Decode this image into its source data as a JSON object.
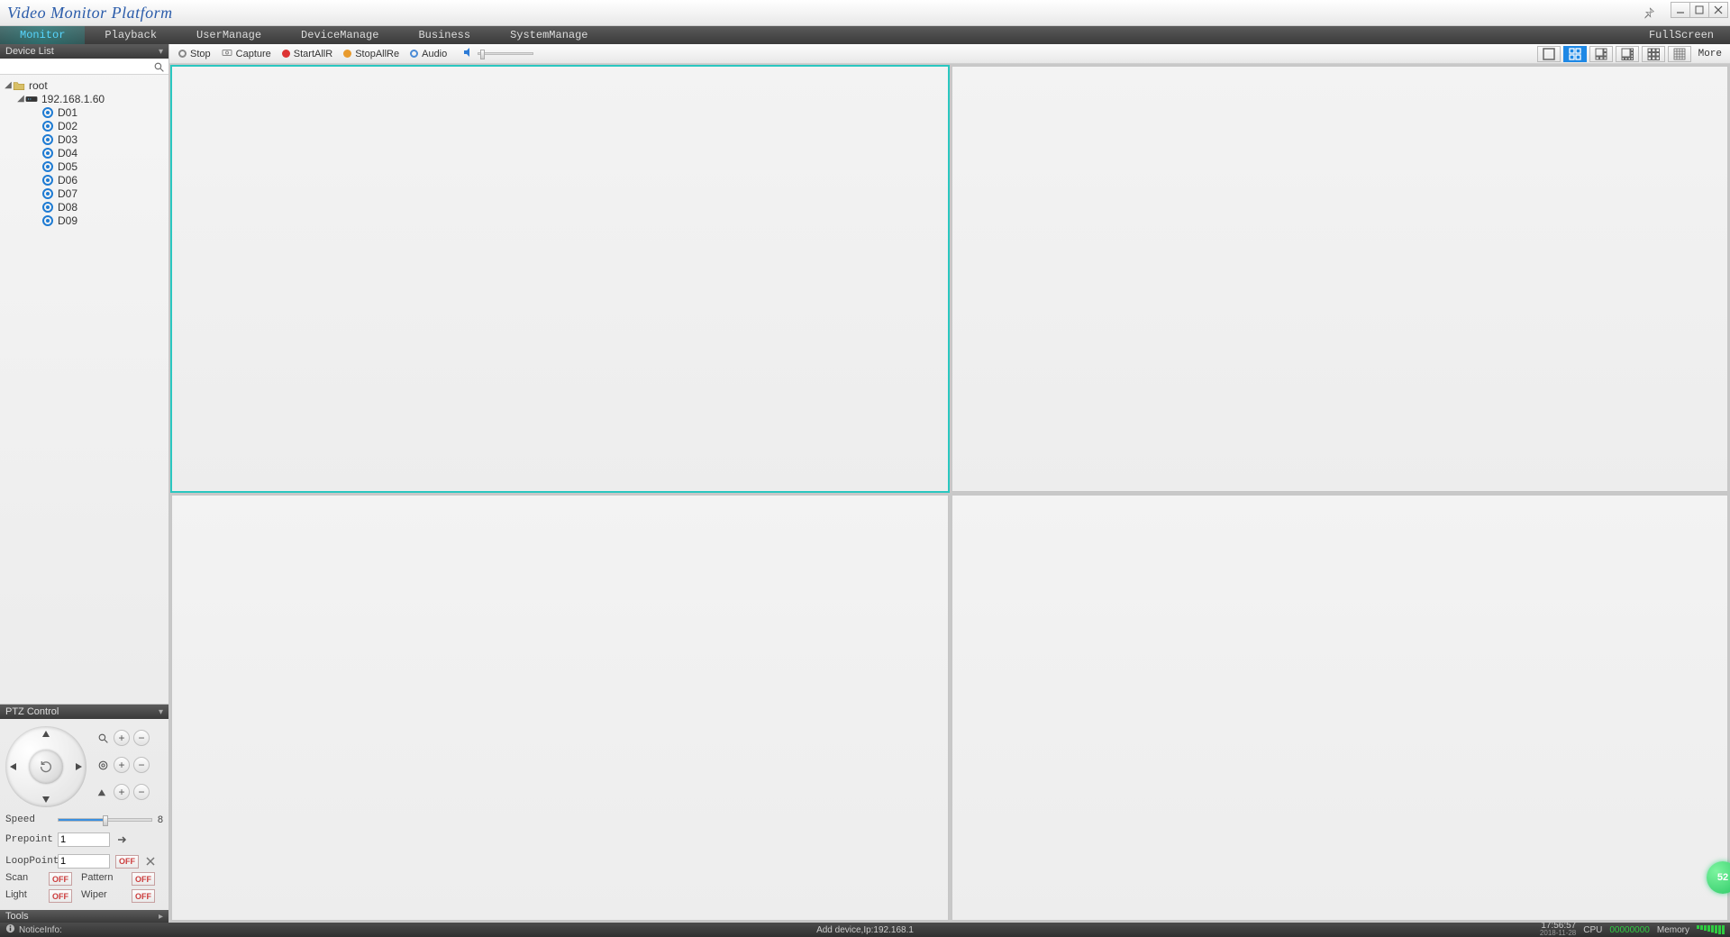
{
  "title": "Video Monitor Platform",
  "menu": {
    "items": [
      "Monitor",
      "Playback",
      "UserManage",
      "DeviceManage",
      "Business",
      "SystemManage"
    ],
    "active": 0,
    "fullscreen": "FullScreen"
  },
  "toolbar": {
    "stop": "Stop",
    "capture": "Capture",
    "start_all": "StartAllR",
    "stop_all": "StopAllRe",
    "audio": "Audio",
    "more": "More"
  },
  "layouts": {
    "active": 1
  },
  "sidebar": {
    "device_list_title": "Device List",
    "search_placeholder": "",
    "root": "root",
    "device_ip": "192.168.1.60",
    "channels": [
      "D01",
      "D02",
      "D03",
      "D04",
      "D05",
      "D06",
      "D07",
      "D08",
      "D09"
    ]
  },
  "ptz": {
    "title": "PTZ Control",
    "speed_label": "Speed",
    "speed_value": "8",
    "prepoint_label": "Prepoint",
    "prepoint_value": "1",
    "looppoint_label": "LoopPoint",
    "looppoint_value": "1",
    "scan_label": "Scan",
    "pattern_label": "Pattern",
    "light_label": "Light",
    "wiper_label": "Wiper",
    "off": "OFF"
  },
  "tools": {
    "title": "Tools"
  },
  "status": {
    "notice_label": "NoticeInfo:",
    "center_msg": "Add device,Ip:192.168.1",
    "time": "17:56:57",
    "date": "2018-11-28",
    "cpu_label": "CPU",
    "mem_label": "Memory",
    "extra": "00000000"
  },
  "badge": "52"
}
